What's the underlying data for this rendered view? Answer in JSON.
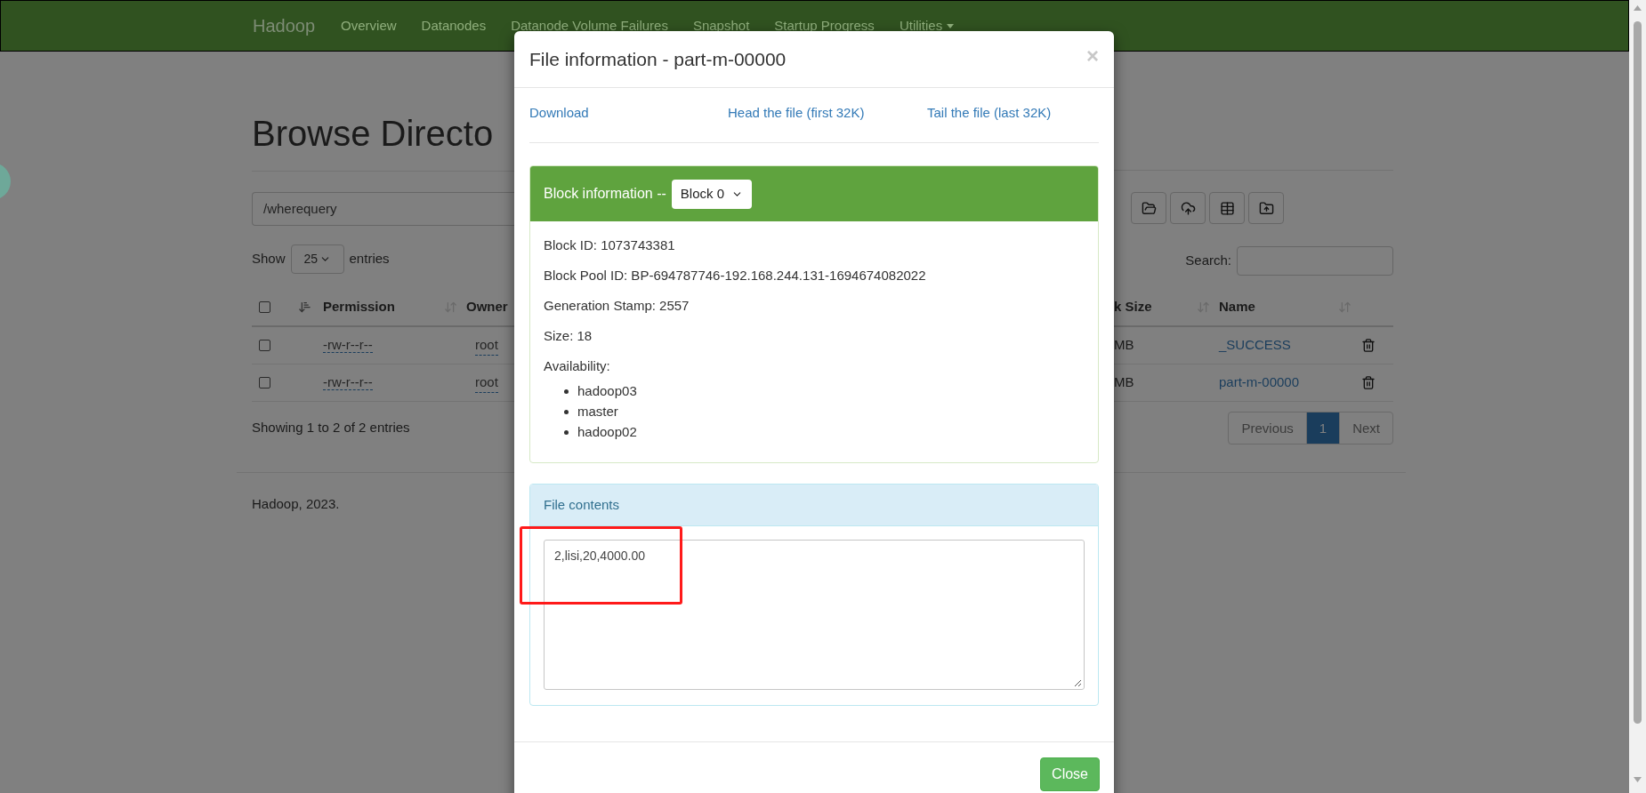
{
  "navbar": {
    "brand": "Hadoop",
    "items": [
      {
        "label": "Overview",
        "has_menu": false
      },
      {
        "label": "Datanodes",
        "has_menu": false
      },
      {
        "label": "Datanode Volume Failures",
        "has_menu": false
      },
      {
        "label": "Snapshot",
        "has_menu": false
      },
      {
        "label": "Startup Progress",
        "has_menu": false
      },
      {
        "label": "Utilities",
        "has_menu": true
      }
    ]
  },
  "page": {
    "title": "Browse Directo",
    "path": "/wherequery",
    "show_label": "Show",
    "page_size": "25",
    "entries_label": "entries",
    "search_label": "Search:",
    "table": {
      "select_all_checked": false,
      "columns": [
        {
          "label": "Permission"
        },
        {
          "label": "Owner"
        },
        {
          "label": "k Size"
        },
        {
          "label": "Name"
        }
      ],
      "rows": [
        {
          "checked": false,
          "permission": "-rw-r--r--",
          "owner": "root",
          "block_size": "MB",
          "name": "_SUCCESS"
        },
        {
          "checked": false,
          "permission": "-rw-r--r--",
          "owner": "root",
          "block_size": "MB",
          "name": "part-m-00000"
        }
      ]
    },
    "info": "Showing 1 to 2 of 2 entries",
    "pagination": [
      {
        "label": "Previous",
        "selected": false,
        "disabled": true
      },
      {
        "label": "1",
        "selected": true,
        "disabled": false
      },
      {
        "label": "Next",
        "selected": false,
        "disabled": true
      }
    ],
    "footer": "Hadoop, 2023."
  },
  "modal": {
    "title": "File information - part-m-00000",
    "close_label": "×",
    "links": [
      "Download",
      "Head the file (first 32K)",
      "Tail the file (last 32K)"
    ],
    "block_panel": {
      "label": "Block information --",
      "block": "Block 0",
      "fields": [
        "Block ID: 1073743381",
        "Block Pool ID: BP-694787746-192.168.244.131-1694674082022",
        "Generation Stamp: 2557",
        "Size: 18"
      ],
      "availability_label": "Availability:",
      "hosts": [
        "hadoop03",
        "master",
        "hadoop02"
      ]
    },
    "contents_panel": {
      "title": "File contents",
      "text": "2,lisi,20,4000.00"
    },
    "button": "Close"
  }
}
